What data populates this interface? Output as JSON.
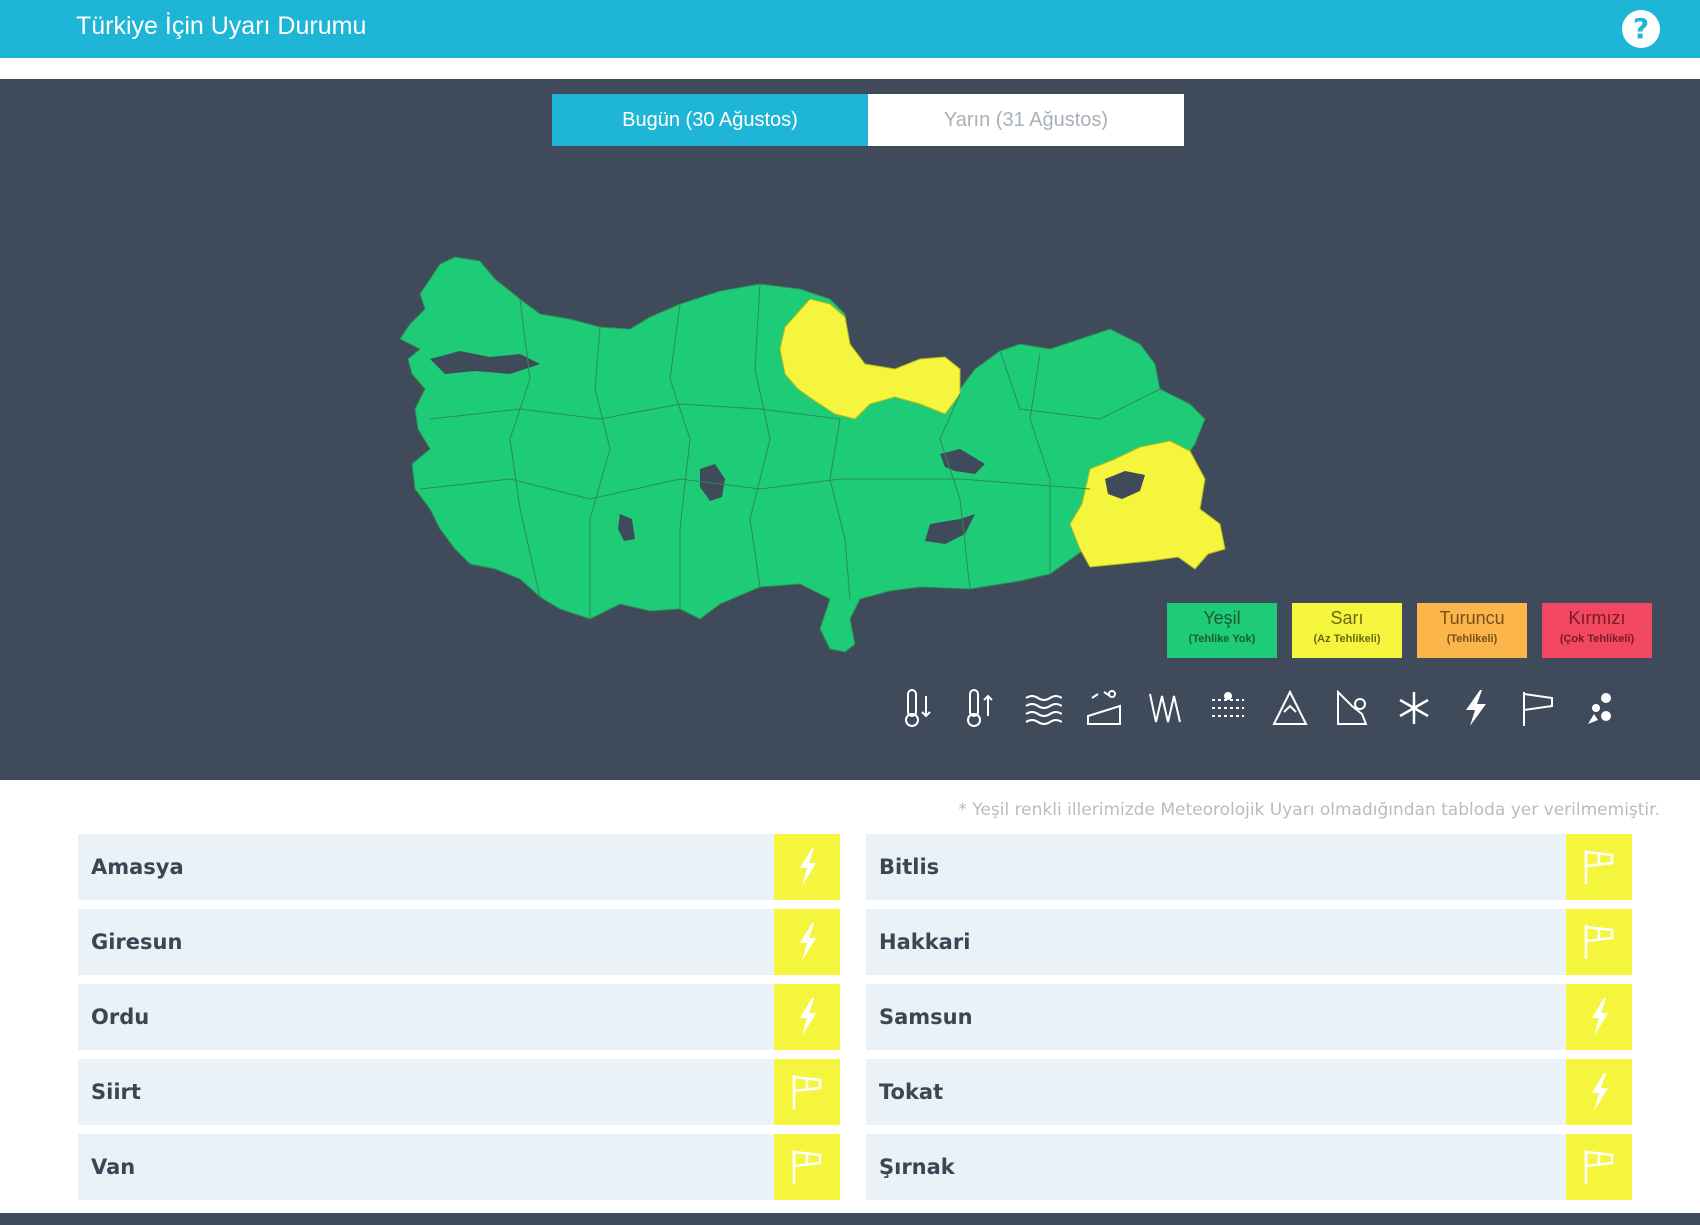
{
  "header": {
    "title": "Türkiye İçin Uyarı Durumu",
    "help_icon": "help-icon"
  },
  "tabs": [
    {
      "label": "Bugün (30 Ağustos)",
      "active": true
    },
    {
      "label": "Yarın (31 Ağustos)",
      "active": false
    }
  ],
  "legend": [
    {
      "label": "Yeşil",
      "sub": "(Tehlike Yok)",
      "color": "#1ecc77",
      "text_color": "#1a5a38"
    },
    {
      "label": "Sarı",
      "sub": "(Az Tehlikeli)",
      "color": "#f5f53d",
      "text_color": "#6a6a10"
    },
    {
      "label": "Turuncu",
      "sub": "(Tehlikeli)",
      "color": "#fbb54a",
      "text_color": "#7a5015"
    },
    {
      "label": "Kırmızı",
      "sub": "(Çok Tehlikeli)",
      "color": "#f14760",
      "text_color": "#7a1a28"
    }
  ],
  "hazard_icons": [
    "low-temperature-icon",
    "high-temperature-icon",
    "fog-icon",
    "avalanche-icon",
    "wind-icon",
    "dust-icon",
    "snow-melt-icon",
    "rain-icon",
    "snow-icon",
    "thunderstorm-icon",
    "strong-wind-icon",
    "hail-icon"
  ],
  "map": {
    "green_color": "#1ecc77",
    "yellow_color": "#f5f53d",
    "lake_color": "#3f4b5a"
  },
  "note": "* Yeşil renkli illerimizde Meteorolojik Uyarı olmadığından tabloda yer verilmemiştir.",
  "warnings": [
    {
      "province": "Amasya",
      "icon": "lightning-icon"
    },
    {
      "province": "Bitlis",
      "icon": "windsock-icon"
    },
    {
      "province": "Giresun",
      "icon": "lightning-icon"
    },
    {
      "province": "Hakkari",
      "icon": "windsock-icon"
    },
    {
      "province": "Ordu",
      "icon": "lightning-icon"
    },
    {
      "province": "Samsun",
      "icon": "lightning-icon"
    },
    {
      "province": "Siirt",
      "icon": "windsock-icon"
    },
    {
      "province": "Tokat",
      "icon": "lightning-icon"
    },
    {
      "province": "Van",
      "icon": "windsock-icon"
    },
    {
      "province": "Şırnak",
      "icon": "windsock-icon"
    }
  ]
}
